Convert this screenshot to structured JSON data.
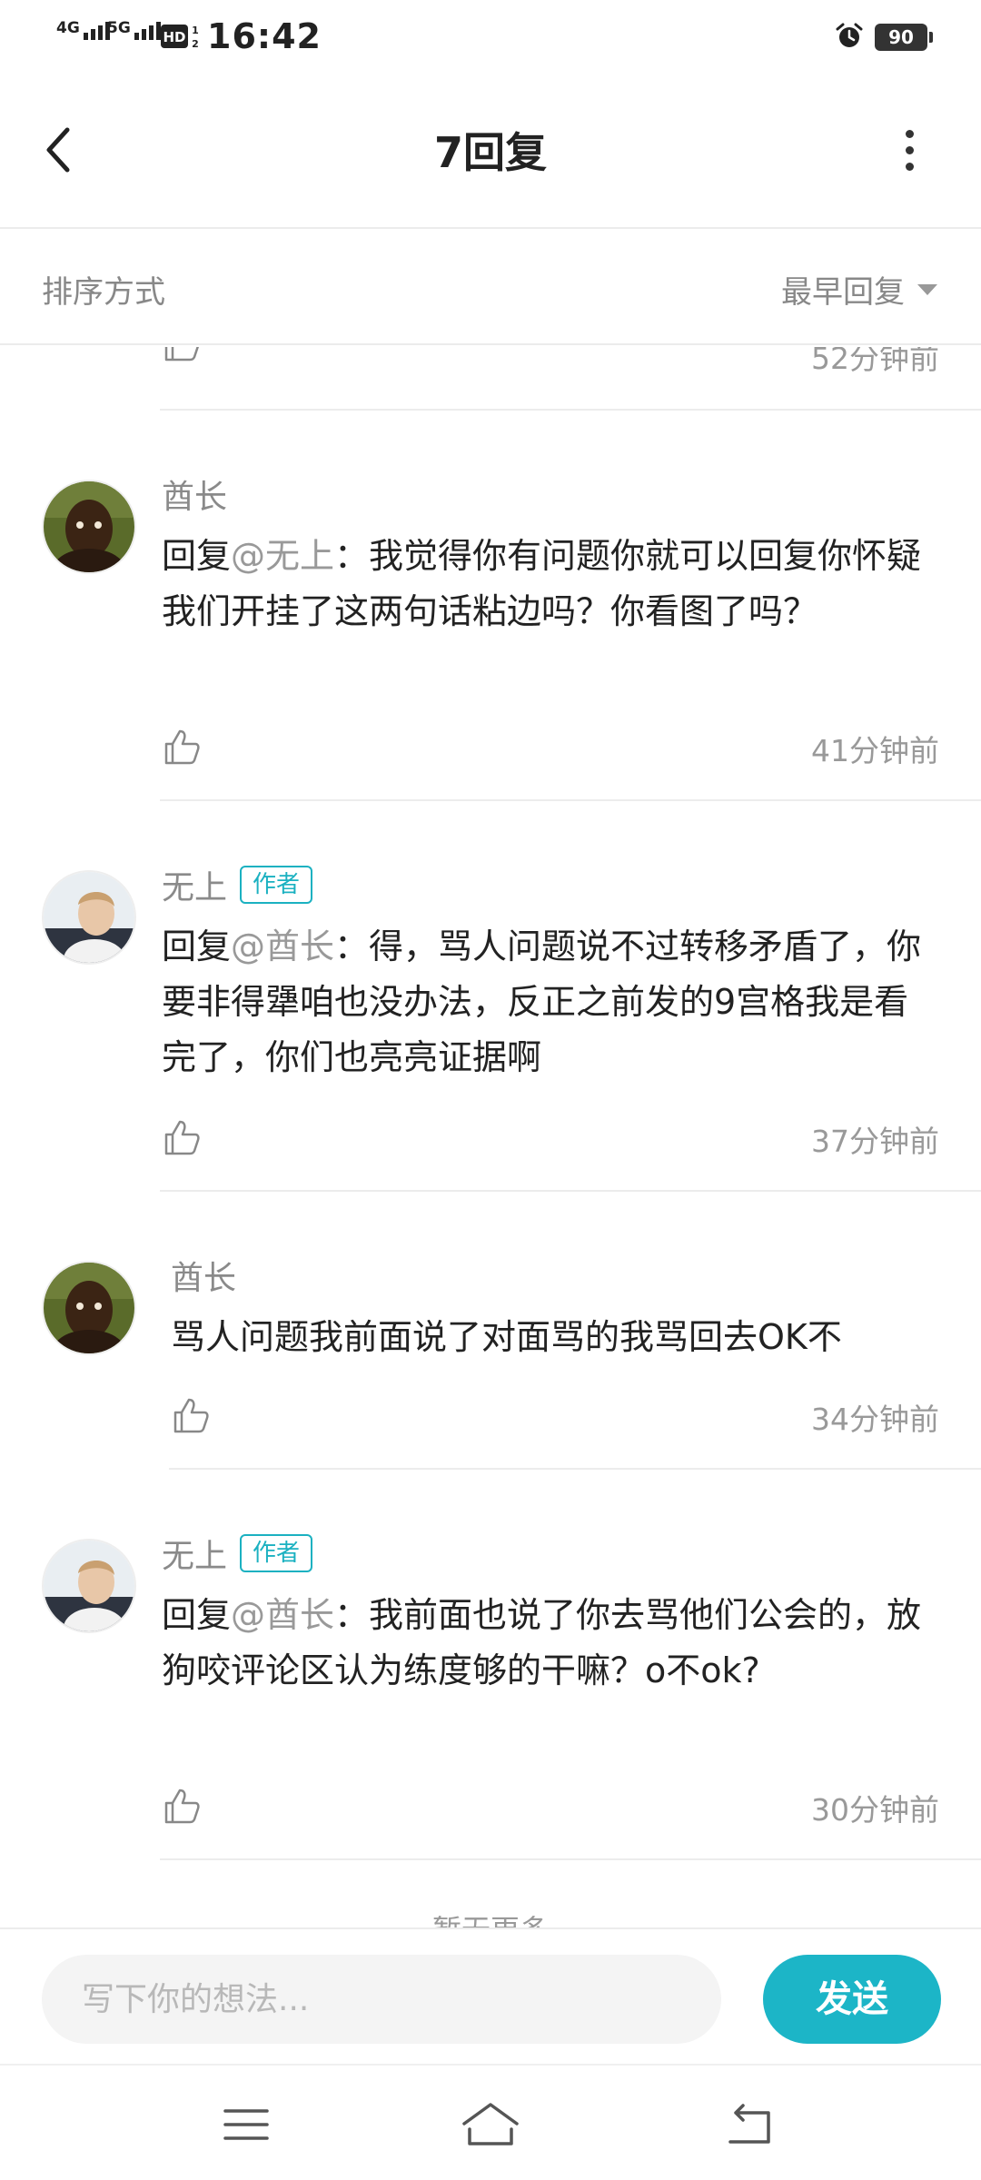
{
  "status_bar": {
    "net1": "4G",
    "net2": "5G",
    "time": "16:42",
    "battery": "90",
    "icons": [
      "signal-4g-icon",
      "signal-5g-icon",
      "hd-call-icon",
      "alarm-icon",
      "battery-icon"
    ]
  },
  "header": {
    "title": "7回复",
    "back_icon": "back-arrow-icon",
    "more_icon": "more-vertical-icon"
  },
  "sort": {
    "label": "排序方式",
    "value": "最早回复"
  },
  "replies": [
    {
      "time": "52分钟前"
    },
    {
      "author": "酋长",
      "prefix": "回复",
      "mention": "@无上",
      "text": "：我觉得你有问题你就可以回复你怀疑我们开挂了这两句话粘边吗？你看图了吗？",
      "time": "41分钟前"
    },
    {
      "author": "无上",
      "badge": "作者",
      "prefix": "回复",
      "mention": "@酋长",
      "text": "：得，骂人问题说不过转移矛盾了，你要非得犟咱也没办法，反正之前发的9宫格我是看完了，你们也亮亮证据啊",
      "time": "37分钟前"
    },
    {
      "author": "酋长",
      "text": "骂人问题我前面说了对面骂的我骂回去OK不",
      "time": "34分钟前"
    },
    {
      "author": "无上",
      "badge": "作者",
      "prefix": "回复",
      "mention": "@酋长",
      "text": "：我前面也说了你去骂他们公会的，放狗咬评论区认为练度够的干嘛？o不ok?",
      "time": "30分钟前"
    }
  ],
  "no_more": "暂无更多",
  "input": {
    "placeholder": "写下你的想法...",
    "send_label": "发送"
  },
  "nav": {
    "icons": [
      "menu-icon",
      "home-icon",
      "back-icon"
    ]
  },
  "colors": {
    "accent": "#1cb5c7",
    "text": "#222222",
    "secondary": "#999999"
  }
}
